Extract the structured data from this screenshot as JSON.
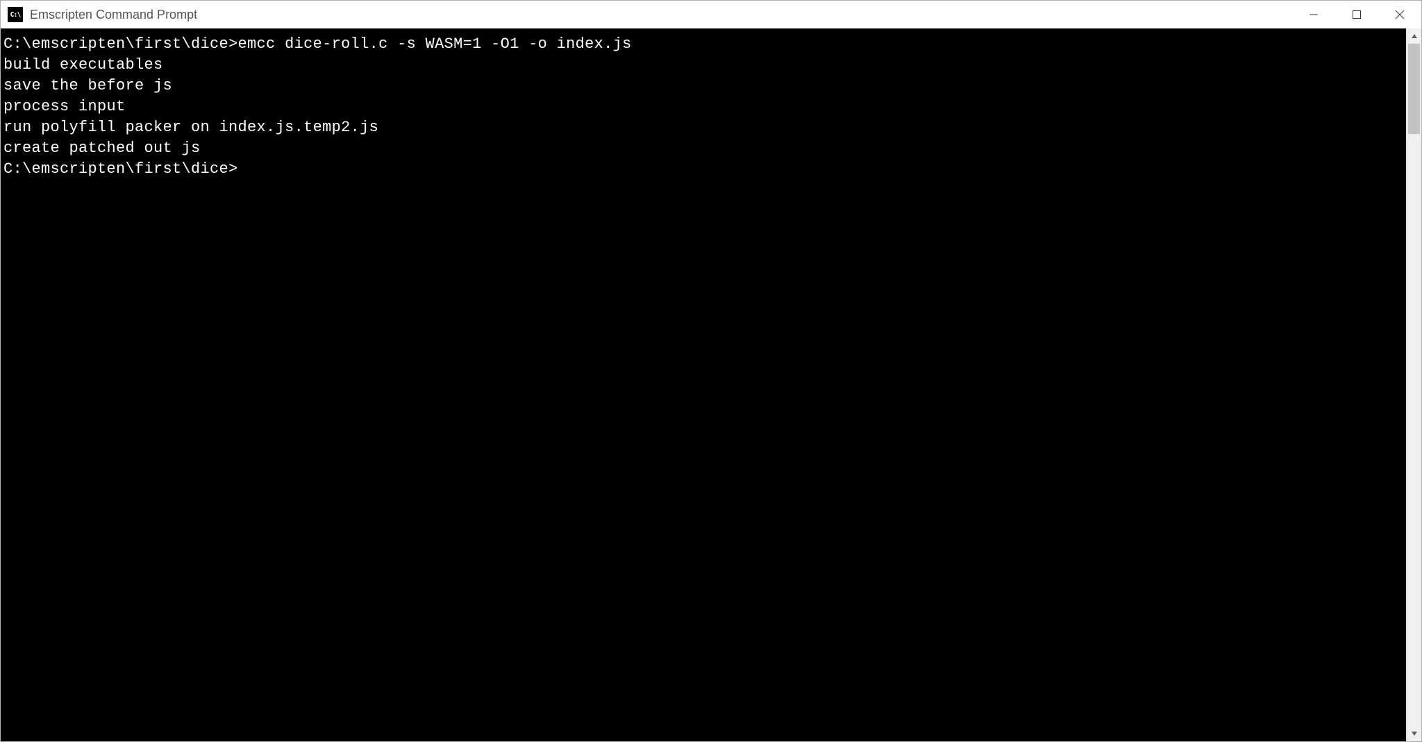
{
  "window": {
    "title": "Emscripten Command Prompt",
    "icon_label": "C:\\",
    "controls": {
      "minimize": "minimize",
      "maximize": "maximize",
      "close": "close"
    }
  },
  "terminal": {
    "lines": [
      "C:\\emscripten\\first\\dice>emcc dice-roll.c -s WASM=1 -O1 -o index.js",
      "build executables",
      "save the before js",
      "process input",
      "run polyfill packer on index.js.temp2.js",
      "create patched out js",
      "",
      "C:\\emscripten\\first\\dice>"
    ]
  }
}
